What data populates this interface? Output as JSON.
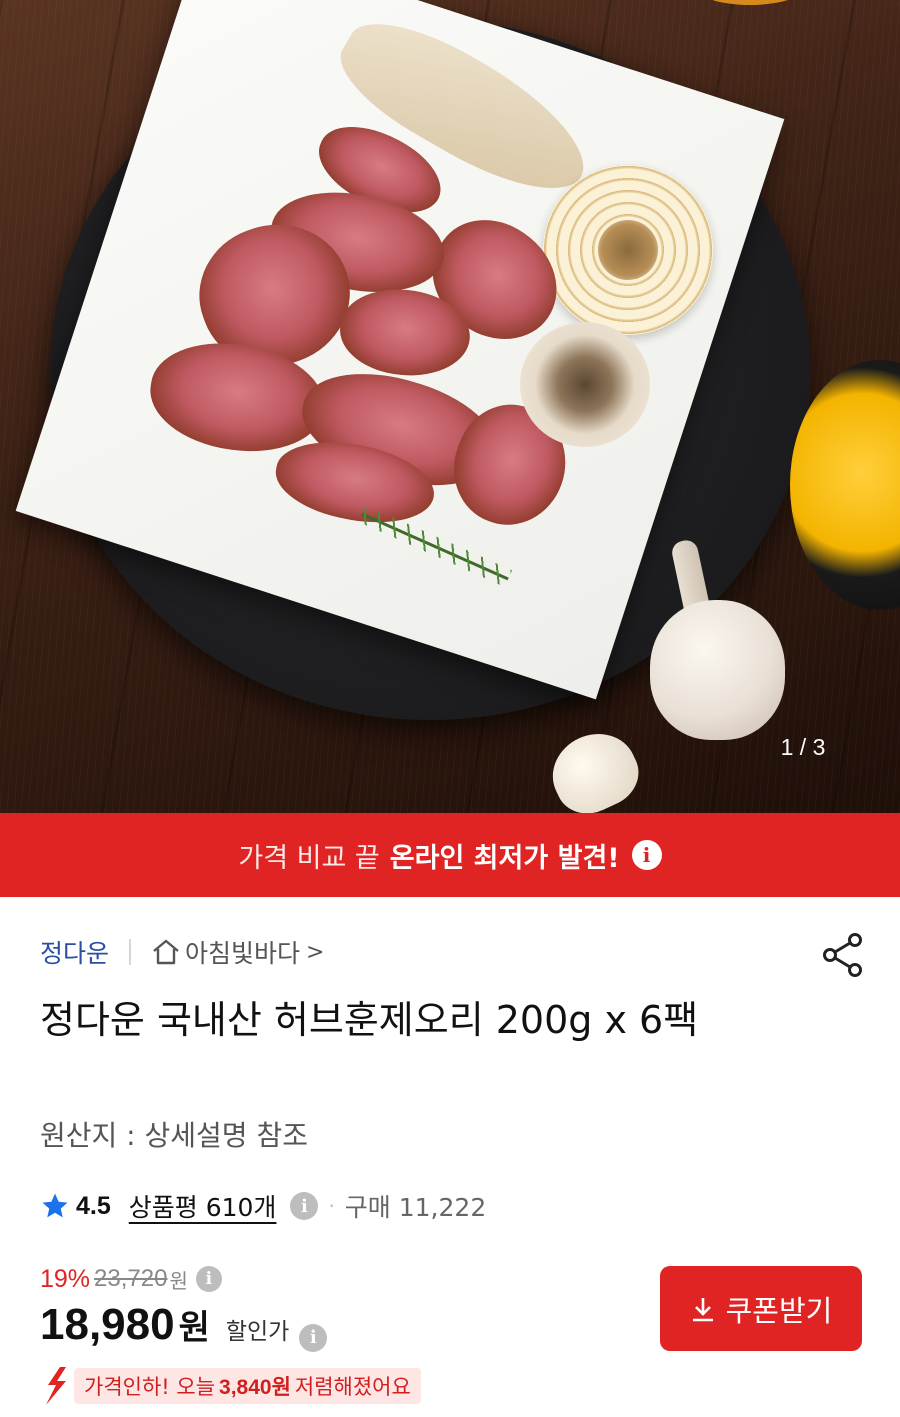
{
  "gallery": {
    "page_indicator": "1 / 3",
    "alt": "smoked duck with onion, mushrooms and garlic on white plate"
  },
  "banner": {
    "text_normal": "가격 비교 끝",
    "text_highlight": "온라인 최저가 발견!",
    "info_icon": "info-icon"
  },
  "seller": {
    "brand": "정다운",
    "store_name": "아침빛바다",
    "store_chevron": ">"
  },
  "product": {
    "title": "정다운 국내산 허브훈제오리 200g x 6팩",
    "origin": "원산지 : 상세설명 참조"
  },
  "rating": {
    "score": "4.5",
    "reviews": "상품평 610개",
    "purchases": "구매 11,222",
    "star_color": "#1a73e8"
  },
  "price": {
    "discount_rate": "19%",
    "original": "23,720",
    "original_unit": "원",
    "sale": "18,980",
    "sale_unit": "원",
    "sale_label": "할인가"
  },
  "coupon": {
    "label": "쿠폰받기"
  },
  "price_drop": {
    "prefix": "가격인하! 오늘",
    "amount": "3,840원",
    "suffix": "저렴해졌어요"
  },
  "colors": {
    "accent_red": "#e02424",
    "brand_blue": "#2a4fa2"
  }
}
